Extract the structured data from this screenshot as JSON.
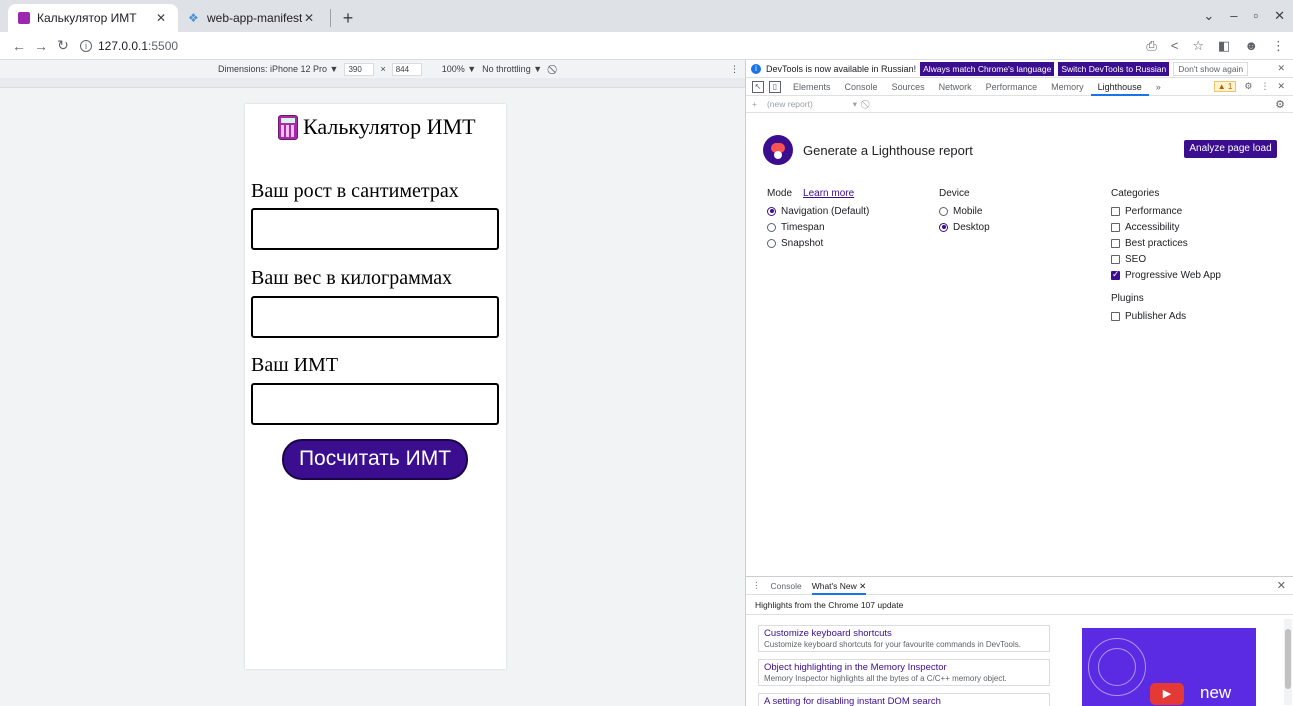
{
  "browser": {
    "tabs": [
      {
        "title": "Калькулятор ИМТ",
        "active": true
      },
      {
        "title": "web-app-manifest generat",
        "active": false
      }
    ],
    "url_host": "127.0.0.1",
    "url_port": ":5500"
  },
  "device_toolbar": {
    "dimensions_label": "Dimensions: iPhone 12 Pro ▼",
    "width": "390",
    "height": "844",
    "zoom": "100% ▼",
    "throttling": "No throttling ▼"
  },
  "app": {
    "title": "Калькулятор ИМТ",
    "height_label": "Ваш рост в сантиметрах",
    "weight_label": "Ваш вес в килограммах",
    "bmi_label": "Ваш ИМТ",
    "calc_button": "Посчитать ИМТ"
  },
  "devtools": {
    "infobar": {
      "message": "DevTools is now available in Russian!",
      "match_btn": "Always match Chrome's language",
      "switch_btn": "Switch DevTools to Russian",
      "dismiss_btn": "Don't show again"
    },
    "tabs": [
      "Elements",
      "Console",
      "Sources",
      "Network",
      "Performance",
      "Memory",
      "Lighthouse"
    ],
    "selected_tab": "Lighthouse",
    "warning_count": "1",
    "report_placeholder": "(new report)",
    "lighthouse": {
      "title": "Generate a Lighthouse report",
      "analyze_button": "Analyze page load",
      "mode_label": "Mode",
      "learn_more": "Learn more",
      "modes": [
        {
          "label": "Navigation (Default)",
          "checked": true
        },
        {
          "label": "Timespan",
          "checked": false
        },
        {
          "label": "Snapshot",
          "checked": false
        }
      ],
      "device_label": "Device",
      "devices": [
        {
          "label": "Mobile",
          "checked": false
        },
        {
          "label": "Desktop",
          "checked": true
        }
      ],
      "categories_label": "Categories",
      "categories": [
        {
          "label": "Performance",
          "checked": false
        },
        {
          "label": "Accessibility",
          "checked": false
        },
        {
          "label": "Best practices",
          "checked": false
        },
        {
          "label": "SEO",
          "checked": false
        },
        {
          "label": "Progressive Web App",
          "checked": true
        }
      ],
      "plugins_label": "Plugins",
      "plugins": [
        {
          "label": "Publisher Ads",
          "checked": false
        }
      ]
    },
    "drawer": {
      "tabs": [
        "Console",
        "What's New"
      ],
      "highlights": "Highlights from the Chrome 107 update",
      "news": [
        {
          "title": "Customize keyboard shortcuts",
          "desc": "Customize keyboard shortcuts for your favourite commands in DevTools."
        },
        {
          "title": "Object highlighting in the Memory Inspector",
          "desc": "Memory Inspector highlights all the bytes of a C/C++ memory object."
        },
        {
          "title": "A setting for disabling instant DOM search",
          "desc": ""
        }
      ],
      "promo_text": "new"
    }
  }
}
